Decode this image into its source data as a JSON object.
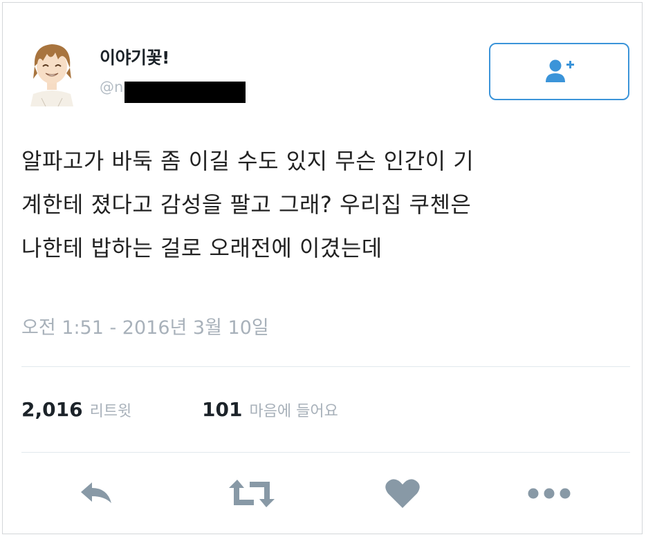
{
  "tweet": {
    "display_name": "이야기꽃!",
    "handle_prefix": "@n",
    "text": "알파고가 바둑 좀 이길 수도 있지 무슨 인간이 기\n계한테 졌다고 감성을 팔고 그래? 우리집 쿠첸은\n나한테 밥하는 걸로 오래전에 이겼는데",
    "timestamp": "오전 1:51 - 2016년 3월 10일"
  },
  "stats": {
    "retweets_count": "2,016",
    "retweets_label": "리트윗",
    "likes_count": "101",
    "likes_label": "마음에 들어요"
  },
  "icons": {
    "follow": "follow-user-icon",
    "reply": "reply-icon",
    "retweet": "retweet-icon",
    "like": "heart-icon",
    "more": "more-icon"
  },
  "colors": {
    "accent": "#3b94d9",
    "icon_gray": "#8899a6",
    "muted_text": "#a8b1ba"
  }
}
